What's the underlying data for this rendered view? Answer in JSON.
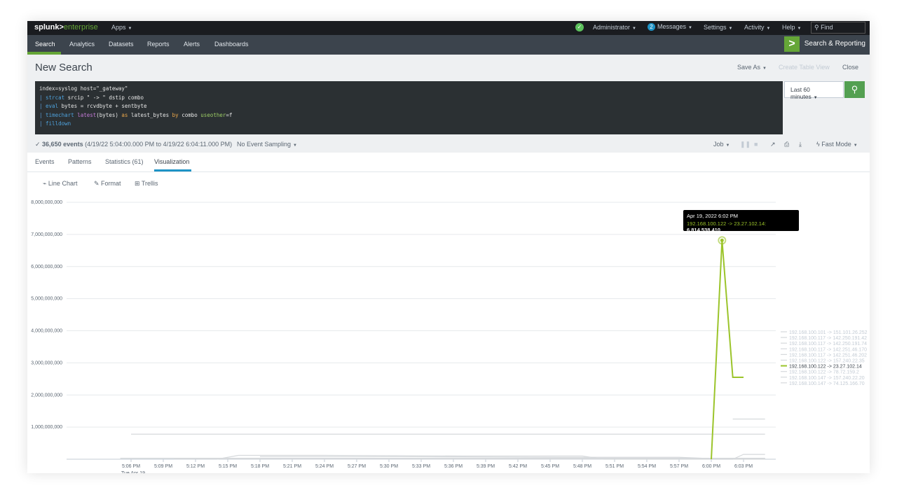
{
  "topbar": {
    "logo_splunk": "splunk>",
    "logo_enterprise": "enterprise",
    "apps": "Apps",
    "admin": "Administrator",
    "messages_count": "2",
    "messages": "Messages",
    "settings": "Settings",
    "activity": "Activity",
    "help": "Help",
    "find_placeholder": "Find"
  },
  "nav": {
    "items": [
      "Search",
      "Analytics",
      "Datasets",
      "Reports",
      "Alerts",
      "Dashboards"
    ],
    "app_title": "Search & Reporting"
  },
  "header": {
    "title": "New Search",
    "save_as": "Save As",
    "create_table_view": "Create Table View",
    "close": "Close"
  },
  "search": {
    "line1": "index=syslog host=\"_gateway\"",
    "line2_cmd": "strcat",
    "line2_rest": "srcip \" -> \" dstip combo",
    "line3_cmd": "eval",
    "line3_rest": "bytes = rcvdbyte + sentbyte",
    "line4_cmd": "timechart",
    "line4_fn": "latest",
    "line4_a": "(bytes)",
    "line4_as": "as",
    "line4_b": "latest_bytes",
    "line4_by": "by",
    "line4_c": "combo",
    "line4_opt": "useother",
    "line4_d": "=f",
    "line5_cmd": "filldown",
    "time_range": "Last 60 minutes"
  },
  "status": {
    "events_count": "36,650 events",
    "events_range": "(4/19/22 5:04:00.000 PM to 4/19/22 6:04:11.000 PM)",
    "sampling": "No Event Sampling",
    "job": "Job",
    "mode": "Fast Mode"
  },
  "tabs": [
    "Events",
    "Patterns",
    "Statistics (61)",
    "Visualization"
  ],
  "viz": {
    "line_chart": "Line Chart",
    "format": "Format",
    "trellis": "Trellis"
  },
  "chart_data": {
    "type": "line",
    "xlabel": "_time",
    "ylabel": "",
    "ylim": [
      0,
      8000000000
    ],
    "y_ticks": [
      "8,000,000,000",
      "7,000,000,000",
      "6,000,000,000",
      "5,000,000,000",
      "4,000,000,000",
      "3,000,000,000",
      "2,000,000,000",
      "1,000,000,000"
    ],
    "x_ticks": [
      "5:06 PM",
      "5:09 PM",
      "5:12 PM",
      "5:15 PM",
      "5:18 PM",
      "5:21 PM",
      "5:24 PM",
      "5:27 PM",
      "5:30 PM",
      "5:33 PM",
      "5:36 PM",
      "5:39 PM",
      "5:42 PM",
      "5:45 PM",
      "5:48 PM",
      "5:51 PM",
      "5:54 PM",
      "5:57 PM",
      "6:00 PM",
      "6:03 PM"
    ],
    "x_first_sub1": "Tue Apr 19",
    "x_first_sub2": "2022",
    "highlight_color": "#9bc42a",
    "muted_color": "#d6d9dc",
    "series": [
      {
        "name": "192.168.100.101 -> 151.101.26.252",
        "x": [
          5.0,
          65.0
        ],
        "values": [
          30000000,
          30000000
        ]
      },
      {
        "name": "192.168.100.117 -> 142.250.191.42",
        "x": [
          6.0,
          65.0
        ],
        "values": [
          780000000,
          780000000
        ]
      },
      {
        "name": "192.168.100.117 -> 142.250.191.74",
        "x": [
          14.0,
          16.0,
          24.0,
          37.0,
          48.0,
          50.0,
          65.0
        ],
        "values": [
          0,
          120000000,
          120000000,
          100000000,
          100000000,
          0,
          0
        ]
      },
      {
        "name": "192.168.100.117 -> 142.251.46.170",
        "x": [
          18.0,
          31.0,
          46.0,
          57.0,
          60.0,
          62.0,
          65.0
        ],
        "values": [
          80000000,
          80000000,
          60000000,
          60000000,
          20000000,
          30000000,
          30000000
        ]
      },
      {
        "name": "192.168.100.117 -> 142.251.46.202",
        "x": [
          62.0,
          65.0
        ],
        "values": [
          1250000000,
          1250000000
        ]
      },
      {
        "name": "192.168.100.122 -> 157.240.22.35",
        "x": [
          60.0,
          62.0,
          63.0,
          65.0
        ],
        "values": [
          0,
          0,
          150000000,
          150000000
        ]
      },
      {
        "name": "192.168.100.122 -> 23.27.102.14",
        "x": [
          60.0,
          61.0,
          62.0,
          63.0
        ],
        "values": [
          0,
          6814538410,
          2550000000,
          2550000000
        ]
      },
      {
        "name": "192.168.100.122 -> 78.72.159.2",
        "x": [
          10.0,
          40.0,
          65.0
        ],
        "values": [
          10000000,
          10000000,
          10000000
        ]
      },
      {
        "name": "192.168.100.147 -> 157.240.22.20",
        "x": [
          20.0,
          50.0,
          65.0
        ],
        "values": [
          5000000,
          5000000,
          5000000
        ]
      },
      {
        "name": "192.168.100.147 -> 74.125.166.70",
        "x": [
          30.0,
          55.0,
          65.0
        ],
        "values": [
          15000000,
          15000000,
          15000000
        ]
      }
    ],
    "highlighted_series_index": 6
  },
  "tooltip": {
    "time": "Apr 19, 2022 6:02 PM",
    "series": "192.168.100.122 -> 23.27.102.14:",
    "value": "6,814,538,410"
  }
}
